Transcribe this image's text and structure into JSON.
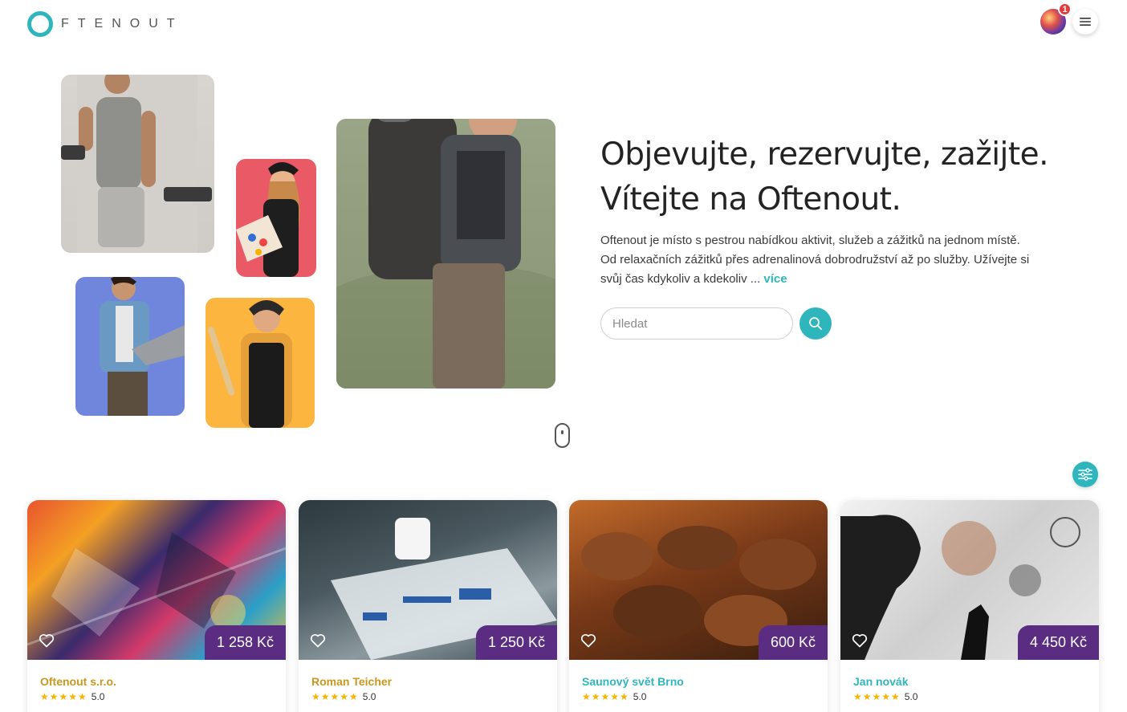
{
  "header": {
    "logo_text": "FTENOUT",
    "notification_count": "1"
  },
  "hero": {
    "title_line1": "Objevujte, rezervujte, zažijte.",
    "title_line2": "Vítejte na Oftenout.",
    "description": "Oftenout je místo s pestrou nabídkou aktivit, služeb a zážitků na jednom místě. Od relaxačních zážitků přes adrenalinová dobrodružství až po služby. Užívejte si svůj čas kdykoliv a kdekoliv ...",
    "more_link": "více",
    "search_placeholder": "Hledat"
  },
  "colors": {
    "accent": "#2fb6bd",
    "price_badge": "#5a2d82",
    "star": "#f4b400"
  },
  "cards": [
    {
      "price": "1 258 Kč",
      "provider": "Oftenout s.r.o.",
      "provider_color": "#c9971d",
      "stars": "★★★★★",
      "rating": "5.0"
    },
    {
      "price": "1 250 Kč",
      "provider": "Roman Teicher",
      "provider_color": "#c9971d",
      "stars": "★★★★★",
      "rating": "5.0"
    },
    {
      "price": "600 Kč",
      "provider": "Saunový svět Brno",
      "provider_color": "#2fb6bd",
      "stars": "★★★★★",
      "rating": "5.0"
    },
    {
      "price": "4 450 Kč",
      "provider": "Jan novák",
      "provider_color": "#2fb6bd",
      "stars": "★★★★★",
      "rating": "5.0"
    }
  ]
}
